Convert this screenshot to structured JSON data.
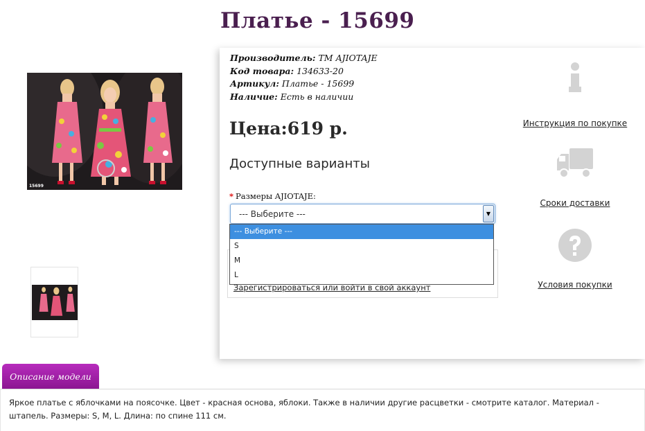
{
  "title": "Платье - 15699",
  "product": {
    "manufacturer_label": "Производитель:",
    "manufacturer_value": "ТМ AJIOTAJE",
    "code_label": "Код товара:",
    "code_value": "134633-20",
    "article_label": "Артикул:",
    "article_value": "Платье - 15699",
    "availability_label": "Наличие:",
    "availability_value": "Есть в наличии",
    "price_label": "Цена:",
    "price_value": "619 р.",
    "photo_code": "15699"
  },
  "variants": {
    "title": "Доступные варианты",
    "required_mark": "*",
    "size_label": "Размеры AJIOTAJE:",
    "selected": "--- Выберите ---",
    "options": [
      "--- Выберите ---",
      "S",
      "M",
      "L"
    ]
  },
  "account": {
    "register_link": "Зарегистрироваться или войти в свой аккаунт"
  },
  "sidebar": {
    "instructions": "Инструкция по покупке",
    "delivery": "Сроки доставки",
    "terms": "Условия покупки"
  },
  "description": {
    "tab_label": "Описание модели",
    "text": "Яркое платье с яблочками на поясочке. Цвет - красная основа, яблоки. Также в наличии другие расцветки - смотрите каталог. Материал - штапель. Размеры: S, M, L. Длина: по спине 111 см."
  },
  "colors": {
    "title": "#4a1f4f",
    "tab": "#9b1ea2",
    "dropdown_active": "#3d8fe0",
    "icon_gray": "#d3d3d3"
  },
  "icons": {
    "info": "info-icon",
    "truck": "truck-icon",
    "question": "question-icon"
  }
}
